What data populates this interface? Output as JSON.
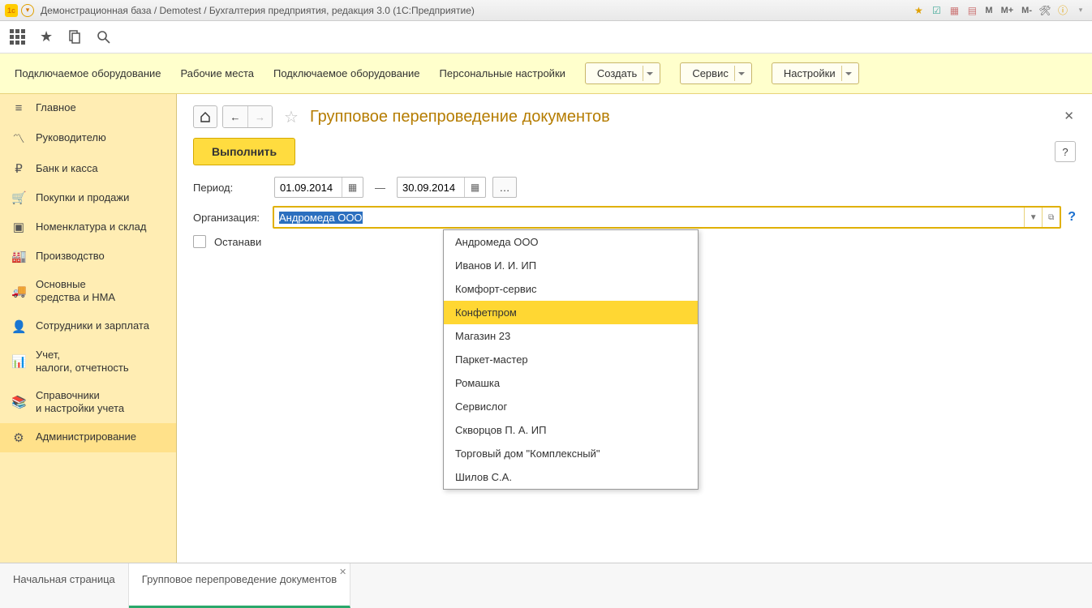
{
  "title_bar": "Демонстрационная база / Demotest / Бухгалтерия предприятия, редакция 3.0  (1С:Предприятие)",
  "m_buttons": [
    "M",
    "M+",
    "M-"
  ],
  "cmd_links": [
    "Подключаемое оборудование",
    "Рабочие места",
    "Подключаемое оборудование",
    "Персональные настройки"
  ],
  "cmd_buttons": {
    "create": "Создать",
    "service": "Сервис",
    "settings": "Настройки"
  },
  "sidebar": [
    {
      "icon": "bars",
      "label": "Главное"
    },
    {
      "icon": "trend",
      "label": "Руководителю"
    },
    {
      "icon": "ruble",
      "label": "Банк и касса"
    },
    {
      "icon": "cart",
      "label": "Покупки и продажи"
    },
    {
      "icon": "boxes",
      "label": "Номенклатура и склад"
    },
    {
      "icon": "plant",
      "label": "Производство"
    },
    {
      "icon": "truck",
      "label": "Основные\nсредства и НМА"
    },
    {
      "icon": "person",
      "label": "Сотрудники и зарплата"
    },
    {
      "icon": "chart",
      "label": "Учет,\nналоги, отчетность"
    },
    {
      "icon": "book",
      "label": "Справочники\nи настройки учета"
    },
    {
      "icon": "gear",
      "label": "Администрирование"
    }
  ],
  "page": {
    "title": "Групповое перепроведение документов",
    "execute": "Выполнить",
    "period_label": "Период:",
    "date_from": "01.09.2014",
    "date_to": "30.09.2014",
    "org_label": "Организация:",
    "org_value": "Андромеда ООО",
    "stop_label": "Останави",
    "help": "?"
  },
  "dropdown": [
    "Андромеда ООО",
    "Иванов И. И. ИП",
    "Комфорт-сервис",
    "Конфетпром",
    "Магазин 23",
    "Паркет-мастер",
    "Ромашка",
    "Сервислог",
    "Скворцов П. А. ИП",
    "Торговый дом \"Комплексный\"",
    "Шилов С.А."
  ],
  "dropdown_highlight": 3,
  "footer_tabs": {
    "home": "Начальная страница",
    "current": "Групповое перепроведение документов"
  }
}
